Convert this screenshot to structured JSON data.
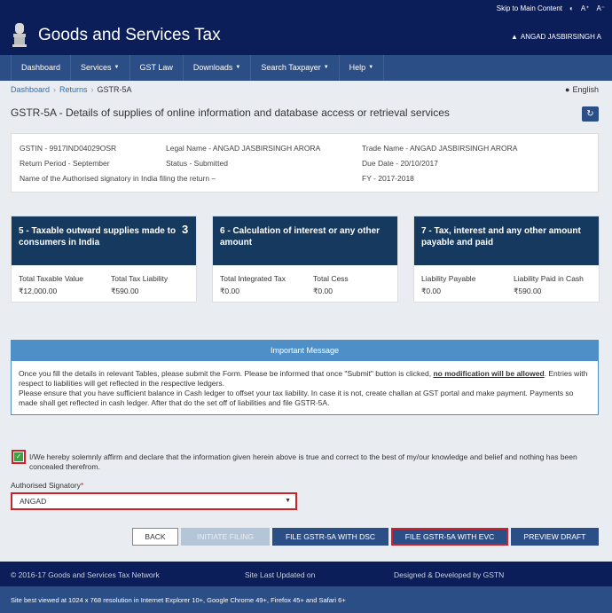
{
  "topbar": {
    "skip": "Skip to Main Content",
    "contrast": "◐",
    "font_plus": "A⁺",
    "font_minus": "A⁻"
  },
  "header": {
    "title": "Goods and Services Tax",
    "user": "ANGAD JASBIRSINGH A"
  },
  "nav": {
    "items": [
      {
        "label": "Dashboard",
        "caret": ""
      },
      {
        "label": "Services",
        "caret": "▼"
      },
      {
        "label": "GST Law",
        "caret": ""
      },
      {
        "label": "Downloads",
        "caret": "▼"
      },
      {
        "label": "Search Taxpayer",
        "caret": "▼"
      },
      {
        "label": "Help",
        "caret": "▼"
      }
    ]
  },
  "breadcrumb": {
    "dashboard": "Dashboard",
    "returns": "Returns",
    "current": "GSTR-5A",
    "sep": "›"
  },
  "language": "English",
  "page_title": "GSTR-5A - Details of supplies of online information and database access or retrieval services",
  "info": {
    "gstin": "GSTIN - 9917IND04029OSR",
    "legal_name": "Legal Name - ANGAD JASBIRSINGH ARORA",
    "trade_name": "Trade Name - ANGAD JASBIRSINGH ARORA",
    "return_period": "Return Period - September",
    "status": "Status - Submitted",
    "due_date": "Due Date - 20/10/2017",
    "signatory_name": "Name of the Authorised signatory in India filing the return –",
    "fy": "FY - 2017-2018"
  },
  "tiles": [
    {
      "title": "5 - Taxable outward supplies made to consumers in India",
      "badge": "3",
      "l1": "Total Taxable Value",
      "v1": "₹12,000.00",
      "l2": "Total Tax Liability",
      "v2": "₹590.00"
    },
    {
      "title": "6 - Calculation of interest or any other amount",
      "badge": "",
      "l1": "Total Integrated Tax",
      "v1": "₹0.00",
      "l2": "Total Cess",
      "v2": "₹0.00"
    },
    {
      "title": "7 - Tax, interest and any other amount payable and paid",
      "badge": "",
      "l1": "Liability Payable",
      "v1": "₹0.00",
      "l2": "Liability Paid in Cash",
      "v2": "₹590.00"
    }
  ],
  "message": {
    "title": "Important Message",
    "p1_start": "Once you fill the details in relevant Tables, please submit the Form. Please be informed that once \"Submit\" button is clicked, ",
    "p1_bold": "no modification will be allowed",
    "p1_end": ". Entries with respect to liabilities will get reflected in the respective ledgers.",
    "p2": "Please ensure that you have sufficient balance in Cash ledger to offset your tax liability. In case it is not, create challan at GST portal and make payment. Payments so made shall get reflected in cash ledger. After that do the set off of liabilities and file GSTR-5A."
  },
  "declaration": "I/We hereby solemnly affirm and declare that the information given herein above is true and correct to the best of my/our knowledge and belief and nothing has been concealed therefrom.",
  "signatory": {
    "label": "Authorised Signatory",
    "required": "*",
    "value": "ANGAD"
  },
  "buttons": {
    "back": "BACK",
    "initiate": "INITIATE FILING",
    "dsc": "FILE GSTR-5A WITH DSC",
    "evc": "FILE GSTR-5A WITH EVC",
    "preview": "PREVIEW DRAFT"
  },
  "footer": {
    "copyright": "© 2016-17 Goods and Services Tax Network",
    "updated": "Site Last Updated on",
    "developed": "Designed & Developed by GSTN",
    "best_viewed": "Site best viewed at 1024 x 768 resolution in Internet Explorer 10+, Google Chrome 49+, Firefox 45+ and Safari 6+"
  },
  "colors": {
    "header": "#0b1e59",
    "nav": "#2c4e86",
    "tile_header": "#15395f",
    "highlight": "#d0202a"
  }
}
